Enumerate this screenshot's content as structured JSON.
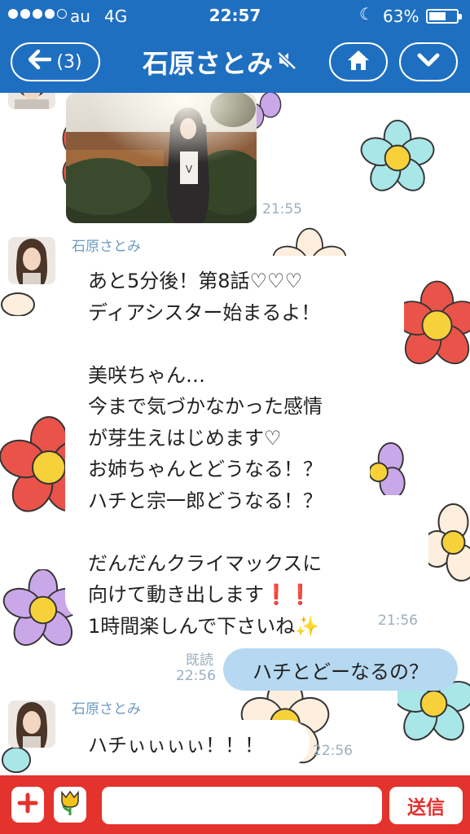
{
  "status_bar": {
    "carrier": "au",
    "network": "4G",
    "time": "22:57",
    "battery_percent": "63%",
    "battery_level": 0.63
  },
  "header": {
    "back_label": "(3)",
    "title": "石原さとみ",
    "icons": [
      "back-arrow-icon",
      "mute-icon",
      "home-icon",
      "chevron-down-icon"
    ],
    "color": "#1f6fc0"
  },
  "messages": [
    {
      "type": "image",
      "direction": "incoming",
      "time": "21:55"
    },
    {
      "type": "text",
      "direction": "incoming",
      "sender": "石原さとみ",
      "text": "あと5分後！第8話♡♡♡\nディアシスター始まるよ！\n\n美咲ちゃん…\n今まで気づかなかった感情\nが芽生えはじめます♡\nお姉ちゃんとどうなる！？\nハチと宗一郎どうなる！？\n\nだんだんクライマックスに\n向けて動き出します❗❗\n1時間楽しんで下さいね✨",
      "time": "21:56"
    },
    {
      "type": "text",
      "direction": "outgoing",
      "read_label": "既読",
      "time": "22:56",
      "text": "ハチとどーなるの？"
    },
    {
      "type": "text",
      "direction": "incoming",
      "sender": "石原さとみ",
      "text": "ハチぃぃぃぃ！！！",
      "time": "22:56"
    }
  ],
  "input_bar": {
    "send_label": "送信",
    "input_value": "",
    "icons": [
      "plus-icon",
      "tulip-sticker-icon"
    ],
    "color": "#e4322d"
  },
  "colors": {
    "outgoing_bubble": "#b6d9f1",
    "sender_name": "#6a9bc4",
    "timestamp": "#9aaebf"
  }
}
